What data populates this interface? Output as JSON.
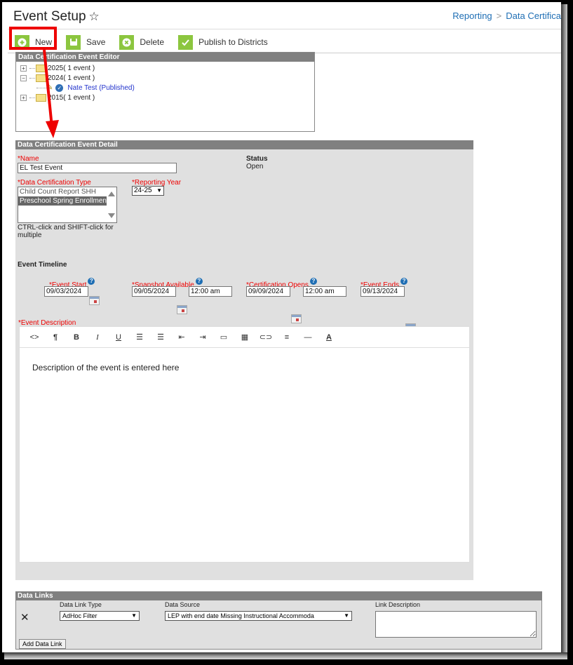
{
  "header": {
    "title": "Event Setup",
    "star_icon": "star-outline-icon",
    "breadcrumb": [
      "Reporting",
      "Data Certifica"
    ]
  },
  "toolbar": {
    "new_label": "New",
    "save_label": "Save",
    "delete_label": "Delete",
    "publish_label": "Publish to Districts"
  },
  "tree_panel": {
    "title": "Data Certification Event Editor",
    "nodes": [
      {
        "label": "2025( 1 event )",
        "expanded": false
      },
      {
        "label": "2024( 1 event )",
        "expanded": true,
        "children": [
          {
            "label": "Nate Test (Published)"
          }
        ]
      },
      {
        "label": "2015( 1 event )",
        "expanded": false
      }
    ]
  },
  "detail": {
    "title": "Data Certification Event Detail",
    "name_label": "*Name",
    "name_value": "EL Test Event",
    "status_label": "Status",
    "status_value": "Open",
    "type_label": "*Data Certification Type",
    "type_options": [
      "Child Count Report SHH",
      "Preschool Spring Enrollment"
    ],
    "type_selected": "Preschool Spring Enrollment",
    "type_hint": "CTRL-click and SHIFT-click for multiple",
    "year_label": "*Reporting Year",
    "year_value": "24-25",
    "timeline_label": "Event Timeline",
    "event_start_label": "*Event Start",
    "event_start_value": "09/03/2024",
    "snapshot_label": "*Snapshot Available",
    "snapshot_date": "09/05/2024",
    "snapshot_time": "12:00 am",
    "cert_opens_label": "*Certification Opens",
    "cert_opens_date": "09/09/2024",
    "cert_opens_time": "12:00 am",
    "event_ends_label": "*Event Ends",
    "event_ends_value": "09/13/2024",
    "description_label": "*Event Description",
    "description_text": "Description of the event is entered here",
    "editor_tools": [
      "code-view",
      "paragraph",
      "bold",
      "italic",
      "underline",
      "unordered-list",
      "ordered-list",
      "outdent",
      "indent",
      "image",
      "table",
      "link",
      "align",
      "horizontal-rule",
      "font-color"
    ],
    "editor_glyphs": [
      "<>",
      "¶",
      "B",
      "I",
      "U",
      "☰",
      "☰",
      "⇤",
      "⇥",
      "▭",
      "▦",
      "⊂⊃",
      "≡",
      "—",
      "A"
    ]
  },
  "data_links": {
    "title": "Data Links",
    "type_label": "Data Link Type",
    "source_label": "Data Source",
    "desc_label": "Link Description",
    "type_value": "AdHoc Filter",
    "source_value": "LEP with end date Missing Instructional Accommoda",
    "desc_value": "",
    "add_label": "Add Data Link"
  },
  "annotation": {
    "highlight_color": "#e00000"
  }
}
